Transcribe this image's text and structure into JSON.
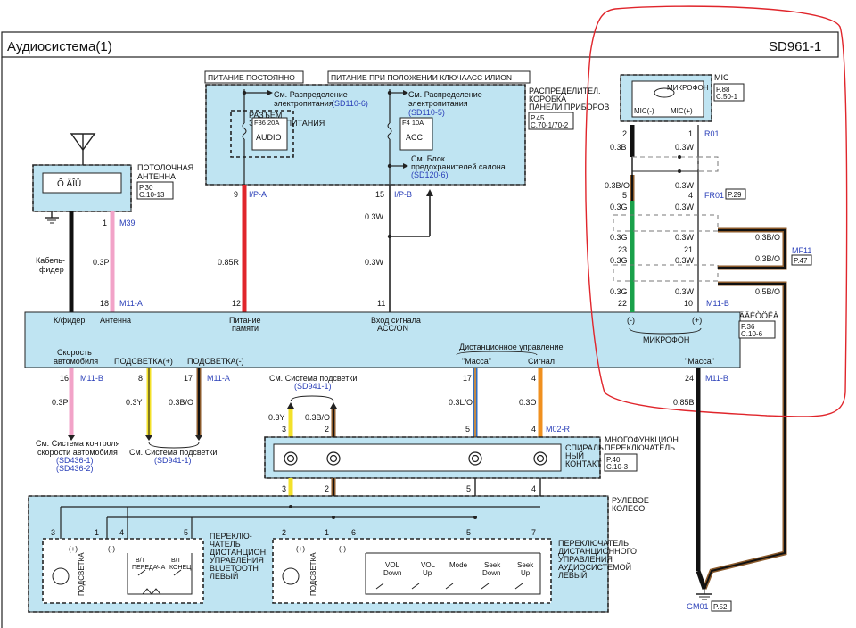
{
  "header": {
    "title": "Аудиосистема(1)",
    "code": "SD961-1"
  },
  "power": {
    "constant_label": "ПИТАНИЕ ПОСТОЯННО",
    "key_label": "ПИТАНИЕ ПРИ ПОЛОЖЕНИИ КЛЮЧААСС ИЛИON",
    "see_dist1": "См. Распределение",
    "see_dist1b": "электропитания",
    "ref1": "(SD110-6)",
    "see_dist2": "См. Распределение",
    "see_dist2b": "электропитания",
    "ref2": "(SD110-5)",
    "connector_title": "РАЗЪЕМ",
    "connector_title2": "ЭЛЕКТРОПИТАНИЯ",
    "fuse1_rating": "F36 20A",
    "fuse1_name": "AUDIO",
    "fuse2_rating": "F4 10A",
    "fuse2_name": "ACC",
    "see_block": "См. Блок",
    "see_block2": "предохранителей салона",
    "ref3": "(SD120-6)",
    "dist_box": "РАСПРЕДЕЛИТЕЛ.",
    "dist_box2": "КОРОБКА",
    "dist_box3": "ПАНЕЛИ ПРИБОРОВ",
    "dist_page": "P.45",
    "dist_page2": "C.70-1/70-2"
  },
  "antenna": {
    "inner": "Ô ÄÎÛ",
    "label1": "ПОТОЛОЧНАЯ",
    "label2": "АНТЕННА",
    "page": "P.30",
    "page2": "C.10-13",
    "cable1": "Кабель-",
    "cable2": "фидер"
  },
  "mic": {
    "title": "MIC",
    "page": "P.88",
    "page2": "C.50-1",
    "inner": "МИКРОФОН",
    "pin_neg": "MIC(-)",
    "pin_pos": "MIC(+)",
    "conn_r01": "R01",
    "conn_fr01": "FR01",
    "fr01_page": "P.29",
    "mf11": "MF11",
    "mf11_page": "P.47",
    "pin2": "2",
    "pin1": "1",
    "pin5": "5",
    "pin4": "4",
    "pin23": "23",
    "pin21": "21",
    "pin22": "22",
    "pin10": "10",
    "w03B": "0.3B",
    "w03W_a": "0.3W",
    "w03BO_a": "0.3B/O",
    "w03W_b": "0.3W",
    "w03G_a": "0.3G",
    "w03W_c": "0.3W",
    "w03G_b": "0.3G",
    "w03W_d": "0.3W",
    "w03G_c": "0.3G",
    "w03W_e": "0.3W",
    "w03G_d": "0.3G",
    "w03W_f": "0.3W",
    "w03BO_b": "0.3B/O",
    "w03BO_c": "0.3B/O",
    "w05BO": "0.5B/O",
    "m11b": "M11-B"
  },
  "wires_top": {
    "pin9": "9",
    "ipa": "I/P-A",
    "pin15": "15",
    "ipb": "I/P-B",
    "w03W_1": "0.3W",
    "w085R": "0.85R",
    "w03W_2": "0.3W",
    "pin12": "12",
    "pin11": "11",
    "pin1": "1",
    "m39": "M39",
    "w03P": "0.3P",
    "pin18": "18",
    "m11a": "M11-A"
  },
  "head_unit": {
    "feeder": "К/фидер",
    "antenna": "Антенна",
    "power1": "Питание",
    "power2": "памяти",
    "acc1": "Вход сигнала",
    "acc2": "ACC/ON",
    "mic_neg": "(-)",
    "mic_pos": "(+)",
    "mic": "МИКРОФОН",
    "name": "ÄÄÉÒÖËÀ",
    "page": "P.36",
    "page2": "C.10-6",
    "speed1": "Скорость",
    "speed2": "автомобиля",
    "illum_pos": "ПОДСВЕТКА(+)",
    "illum_neg": "ПОДСВЕТКА(-)",
    "remote": "Дистанционное управление",
    "remote_gnd": "\"Масса\"",
    "remote_sig": "Сигнал",
    "gnd": "\"Масса\""
  },
  "wires_bottom": {
    "pin16": "16",
    "m11b1": "M11-B",
    "w03P": "0.3P",
    "pin8": "8",
    "pin17": "17",
    "m11a": "M11-A",
    "w03Y": "0.3Y",
    "w03BO": "0.3B/O",
    "pin17b": "17",
    "pin4": "4",
    "w03LO": "0.3L/O",
    "w03O": "0.3O",
    "pin5b": "5",
    "pin4b": "4",
    "m02r": "M02-R",
    "pin24": "24",
    "m11b2": "M11-B",
    "w085B": "0.85B",
    "gm01": "GM01",
    "gm01_page": "P.52",
    "see_light": "См. Система подсветки",
    "ref_light": "(SD941-1)",
    "w03Y_2": "0.3Y",
    "w03BO_2": "0.3B/O",
    "pin3": "3",
    "pin2": "2",
    "pin5": "5",
    "pin4c": "4"
  },
  "refs": {
    "speed1": "См. Система контроля",
    "speed2": "скорости автомобиля",
    "speed3": "(SD436-1)",
    "speed4": "(SD436-2)",
    "light1": "См. Система подсветки",
    "light2": "(SD941-1)"
  },
  "clock_spring": {
    "label1": "МНОГОФУНКЦИОН.",
    "label2": "ПЕРЕКЛЮЧАТЕЛЬ",
    "label3": "СПИРАЛЬ",
    "label4": "НЫЙ",
    "label5": "КОНТАКТ",
    "page": "P.40",
    "page2": "C.10-3",
    "p3": "3",
    "p2": "2",
    "p5": "5",
    "p4": "4"
  },
  "steering": {
    "label1": "РУЛЕВОЕ",
    "label2": "КОЛЕСО",
    "bt_pins": [
      "3",
      "1",
      "4",
      "5"
    ],
    "audio_pins": [
      "2",
      "1",
      "6",
      "5",
      "7"
    ],
    "plus": "(+)",
    "minus": "(-)",
    "illum": "ПОДСВЕТКА",
    "bt_send": "B/T",
    "bt_send2": "ПЕРЕДАЧА",
    "bt_end": "B/T",
    "bt_end2": "КОНЕЦ",
    "bt_sw1": "ПЕРЕКЛЮ-",
    "bt_sw2": "ЧАТЕЛЬ",
    "bt_sw3": "ДИСТАНЦИОН.",
    "bt_sw4": "УПРАВЛЕНИЯ",
    "bt_sw5": "BLUETOOTH",
    "bt_sw6": "ЛЕВЫЙ",
    "vol_down1": "VOL",
    "vol_down2": "Down",
    "vol_up1": "VOL",
    "vol_up2": "Up",
    "mode": "Mode",
    "seek_down1": "Seek",
    "seek_down2": "Down",
    "seek_up1": "Seek",
    "seek_up2": "Up",
    "au_sw1": "ПЕРЕКЛЮЧАТЕЛЬ",
    "au_sw2": "ДИСТАНЦИОННОГО",
    "au_sw3": "УПРАВЛЕНИЯ",
    "au_sw4": "АУДИОСИСТЕМОЙ",
    "au_sw5": "ЛЕВЫЙ"
  },
  "colors": {
    "pink": "#f2a3c8",
    "red": "#e0252b",
    "black": "#111111",
    "yellow": "#f3e12a",
    "brown": "#8b5a2b",
    "orange": "#f0901f",
    "blue": "#2f6fc4",
    "green": "#1aa14a",
    "fill": "#bfe4f2",
    "annot": "#e0252b"
  }
}
